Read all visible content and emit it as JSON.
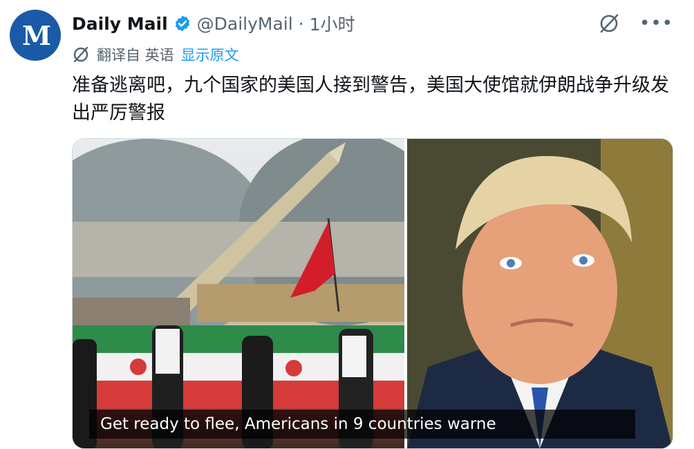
{
  "account": {
    "name": "Daily Mail",
    "handle": "@DailyMail",
    "separator": "·",
    "time": "1小时",
    "avatar_letters": "M"
  },
  "translation": {
    "translated_from": "翻译自 英语",
    "show_original": "显示原文"
  },
  "tweet": {
    "text": "准备逃离吧，九个国家的美国人接到警告，美国大使馆就伊朗战争升级发出严厉警报"
  },
  "media": {
    "caption": "Get ready to flee, Americans in 9 countries warne"
  },
  "icons": {
    "verified": "verified-badge-icon",
    "grok": "grok-icon",
    "more": "more-icon",
    "translate": "translate-icon"
  },
  "colors": {
    "brand_blue": "#1a5aa8",
    "link": "#1d9bf0",
    "secondary_text": "#536471"
  }
}
